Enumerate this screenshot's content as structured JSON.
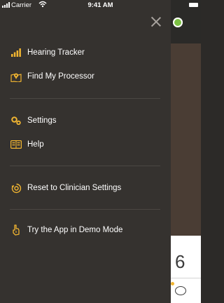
{
  "status_bar": {
    "carrier": "Carrier",
    "time": "9:41 AM"
  },
  "menu": {
    "groups": [
      {
        "items": [
          {
            "label": "Hearing Tracker",
            "icon": "bar-chart-icon"
          },
          {
            "label": "Find My Processor",
            "icon": "map-pin-icon"
          }
        ]
      },
      {
        "items": [
          {
            "label": "Settings",
            "icon": "gears-icon"
          },
          {
            "label": "Help",
            "icon": "help-book-icon"
          }
        ]
      },
      {
        "items": [
          {
            "label": "Reset to Clinician Settings",
            "icon": "reset-icon"
          }
        ]
      },
      {
        "items": [
          {
            "label": "Try the App in Demo Mode",
            "icon": "demo-hand-icon"
          }
        ]
      }
    ]
  },
  "background_screen": {
    "counter_value": "6"
  },
  "colors": {
    "drawer_background": "#35322f",
    "icon_accent": "#f1b531",
    "separator": "#4b4743",
    "status_ok": "#7bc043"
  }
}
